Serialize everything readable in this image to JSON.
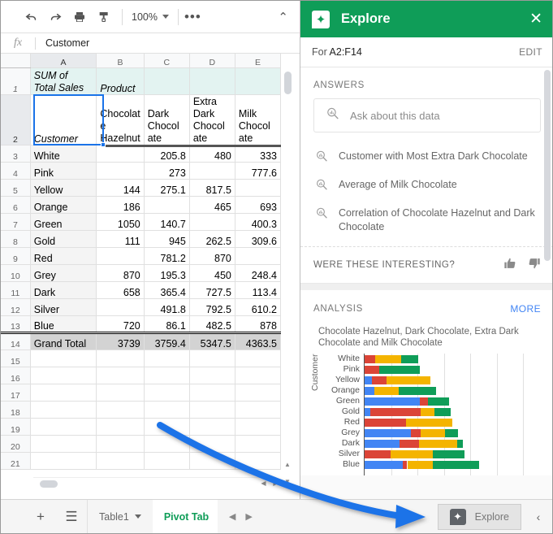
{
  "toolbar": {
    "undo": "undo-arrow",
    "redo": "redo-arrow",
    "print": "printer",
    "paint": "paint-format",
    "zoom_value": "100%",
    "more": "•••",
    "collapse": "⌃"
  },
  "formula_bar": {
    "fx": "fx",
    "value": "Customer"
  },
  "sheet": {
    "column_headers": [
      "A",
      "B",
      "C",
      "D",
      "E"
    ],
    "row_numbers": [
      "1",
      "2",
      "3",
      "4",
      "5",
      "6",
      "7",
      "8",
      "9",
      "10",
      "11",
      "12",
      "13",
      "14",
      "15",
      "16",
      "17",
      "18",
      "19",
      "20",
      "21"
    ],
    "pivot_label": "SUM of\nTotal Sales",
    "pivot_label_line1": "SUM of",
    "pivot_label_line2": "Total Sales",
    "product_label": "Product",
    "customer_label": "Customer",
    "headers": [
      "Chocolat\ne\nHazelnut",
      "Dark\nChocol\nate",
      "Extra\nDark\nChocol\nate",
      "Milk\nChocol\nate"
    ],
    "header_b": "Chocolate Hazelnut",
    "header_c": "Dark Chocolate",
    "header_d": "Extra Dark Chocolate",
    "header_e": "Milk Chocolate",
    "rows": [
      {
        "customer": "White",
        "b": "",
        "c": "205.8",
        "d": "480",
        "e": "333"
      },
      {
        "customer": "Pink",
        "b": "",
        "c": "273",
        "d": "",
        "e": "777.6"
      },
      {
        "customer": "Yellow",
        "b": "144",
        "c": "275.1",
        "d": "817.5",
        "e": ""
      },
      {
        "customer": "Orange",
        "b": "186",
        "c": "",
        "d": "465",
        "e": "693"
      },
      {
        "customer": "Green",
        "b": "1050",
        "c": "140.7",
        "d": "",
        "e": "400.3"
      },
      {
        "customer": "Gold",
        "b": "111",
        "c": "945",
        "d": "262.5",
        "e": "309.6"
      },
      {
        "customer": "Red",
        "b": "",
        "c": "781.2",
        "d": "870",
        "e": ""
      },
      {
        "customer": "Grey",
        "b": "870",
        "c": "195.3",
        "d": "450",
        "e": "248.4"
      },
      {
        "customer": "Dark",
        "b": "658",
        "c": "365.4",
        "d": "727.5",
        "e": "113.4"
      },
      {
        "customer": "Silver",
        "b": "",
        "c": "491.8",
        "d": "792.5",
        "e": "610.2"
      },
      {
        "customer": "Blue",
        "b": "720",
        "c": "86.1",
        "d": "482.5",
        "e": "878"
      }
    ],
    "total_row": {
      "customer": "Grand Total",
      "b": "3739",
      "c": "3759.4",
      "d": "5347.5",
      "e": "4363.5"
    }
  },
  "explore": {
    "title": "Explore",
    "logo_icon": "explore-star-icon",
    "close_icon": "close-icon",
    "for_prefix": "For ",
    "range": "A2:F14",
    "edit_label": "EDIT",
    "answers_label": "ANSWERS",
    "ask_placeholder": "Ask about this data",
    "suggestions": [
      "Customer with Most Extra Dark Chocolate",
      "Average of Milk Chocolate",
      "Correlation of Chocolate Hazelnut and Dark Chocolate"
    ],
    "interesting_label": "WERE THESE INTERESTING?",
    "thumb_up": "👍",
    "thumb_down": "👎",
    "analysis_label": "ANALYSIS",
    "more_label": "MORE"
  },
  "chart_data": {
    "type": "bar",
    "title": "Chocolate Hazelnut, Dark Chocolate, Extra Dark Chocolate and Milk Chocolate",
    "orientation": "horizontal",
    "stacked": true,
    "ylabel": "Customer",
    "xlabel": "",
    "grid": true,
    "legend": "none",
    "categories": [
      "White",
      "Pink",
      "Yellow",
      "Orange",
      "Green",
      "Gold",
      "Red",
      "Grey",
      "Dark",
      "Silver",
      "Blue"
    ],
    "xlim": [
      0,
      3500
    ],
    "series": [
      {
        "name": "Chocolate Hazelnut",
        "color": "#4285F4",
        "values": [
          0,
          0,
          144,
          186,
          1050,
          111,
          0,
          870,
          658,
          0,
          720
        ]
      },
      {
        "name": "Dark Chocolate",
        "color": "#DB4437",
        "values": [
          205.8,
          273,
          275.1,
          0,
          140.7,
          945,
          781.2,
          195.3,
          365.4,
          491.8,
          86.1
        ]
      },
      {
        "name": "Extra Dark Chocolate",
        "color": "#F4B400",
        "values": [
          480,
          0,
          817.5,
          465,
          0,
          262.5,
          870,
          450,
          727.5,
          792.5,
          482.5
        ]
      },
      {
        "name": "Milk Chocolate",
        "color": "#0F9D58",
        "values": [
          333,
          777.6,
          0,
          693,
          400.3,
          309.6,
          0,
          248.4,
          113.4,
          610.2,
          878
        ]
      }
    ]
  },
  "bottom": {
    "add_sheet": "+",
    "all_sheets": "☰",
    "tabs": [
      {
        "label": "Table1",
        "active": false,
        "has_caret": true
      },
      {
        "label": "Pivot Tab",
        "active": true,
        "has_caret": false
      }
    ],
    "nav_prev": "◀",
    "nav_next": "▶",
    "explore_label": "Explore",
    "collapse": "‹"
  }
}
